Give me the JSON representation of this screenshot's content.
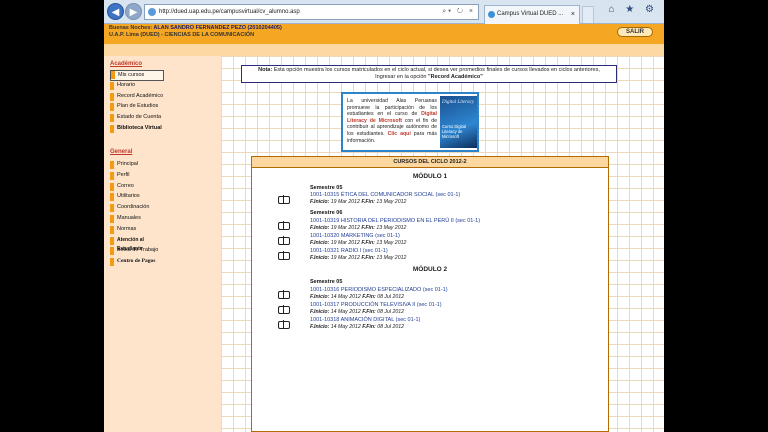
{
  "browser": {
    "url": "http://dued.uap.edu.pe/campusvirtual/cv_alumno.asp",
    "tab_title": "Campus Virtual DUED ...",
    "tab_close": "×",
    "chrome_icons": "⌂ ★ ⚙",
    "address_icons": "⌕▾ ↻ ×",
    "back": "◀",
    "forward": "▶"
  },
  "header": {
    "greeting_prefix": "Buenas Noches: ",
    "user_name": "ALAN SANDRO FERNANDEZ PEZO (2010204405)",
    "faculty": "U.A.P. Lima (DUED) - CIENCIAS DE LA COMUNICACIÓN",
    "salir_label": "SALIR"
  },
  "sidebar": {
    "academic_title": "Académico",
    "academic_items": [
      {
        "label": "Mis cursos",
        "selected": true
      },
      {
        "label": "Horario"
      },
      {
        "label": "Record Académico"
      },
      {
        "label": "Plan de Estudios"
      },
      {
        "label": "Estado de Cuenta"
      },
      {
        "label": "Biblioteca Virtual"
      }
    ],
    "general_title": "General",
    "general_items": [
      {
        "label": "Principal"
      },
      {
        "label": "Perfil"
      },
      {
        "label": "Correo"
      },
      {
        "label": "Utilitarios"
      },
      {
        "label": "Coordinación"
      },
      {
        "label": "Manuales"
      },
      {
        "label": "Normas"
      },
      {
        "label": "Atención al Estudiante"
      },
      {
        "label": "Bolsa de Trabajo"
      },
      {
        "label": "Centro de Pagos"
      }
    ]
  },
  "nota": {
    "label": "Nota:",
    "line1": " Esta opción muestra los cursos matriculados en el ciclo actual, si desea ver promedios finales de cursos llevados en ciclos anteriores,",
    "line2": "Ingresar en la opción ",
    "link": "\"Record Académico\""
  },
  "promo": {
    "text_a": "La universidad Alas Peruanas promueve la participación de los estudiantes en el curso de ",
    "highlight": "Digital Literacy de Microsoft",
    "text_b": " con el fin de contribuir al aprendizaje autónomo de los estudiantes. ",
    "click_here": "Clic aquí",
    "text_c": " para más información.",
    "image_title": "Digital Literacy",
    "image_sub": "Curso Digital Literacy de Microsoft"
  },
  "cursos": {
    "title": "CURSOS DEL CICLO 2012-2",
    "modules": [
      {
        "label": "MÓDULO 1",
        "semesters": [
          {
            "label": "Semestre 05",
            "courses": [
              {
                "title": "1001-10315 ÉTICA DEL COMUNICADOR SOCIAL",
                "section": "(sec 01-1)",
                "start": "19 Mar 2012",
                "end": "13 May 2012"
              }
            ]
          },
          {
            "label": "Semestre 06",
            "courses": [
              {
                "title": "1001-10319 HISTORIA DEL PERIODISMO EN EL PERÚ II",
                "section": "(sec 01-1)",
                "start": "19 Mar 2012",
                "end": "13 May 2012"
              },
              {
                "title": "1001-10320 MARKETING",
                "section": "(sec 01-1)",
                "start": "19 Mar 2012",
                "end": "13 May 2012"
              },
              {
                "title": "1001-10321 RADIO I",
                "section": "(sec 01-1)",
                "start": "19 Mar 2012",
                "end": "13 May 2012"
              }
            ]
          }
        ]
      },
      {
        "label": "MÓDULO 2",
        "semesters": [
          {
            "label": "Semestre 05",
            "courses": [
              {
                "title": "1001-10316 PERIODISMO ESPECIALIZADO",
                "section": "(sec 01-1)",
                "start": "14 May 2012",
                "end": "08 Jul 2012"
              },
              {
                "title": "1001-10317 PRODUCCIÓN TELEVISIVA II",
                "section": "(sec 01-1)",
                "start": "14 May 2012",
                "end": "08 Jul 2012"
              },
              {
                "title": "1001-10318 ANIMACIÓN DIGITAL",
                "section": "(sec 01-1)",
                "start": "14 May 2012",
                "end": "08 Jul 2012"
              }
            ]
          }
        ]
      }
    ],
    "start_label": "F.Inicio:",
    "end_label": "F.Fin:"
  }
}
